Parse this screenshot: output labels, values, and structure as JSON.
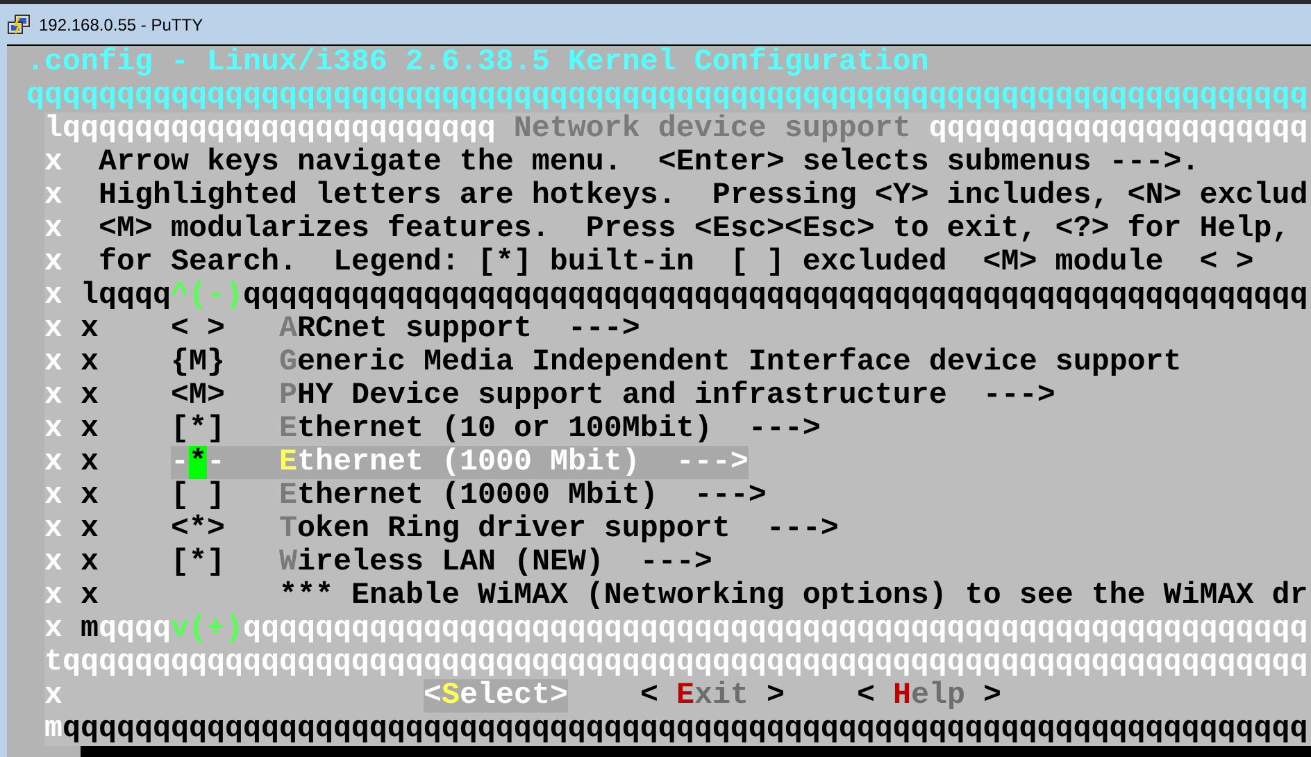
{
  "window": {
    "title": "192.168.0.55 - PuTTY"
  },
  "terminal": {
    "title": ".config - Linux/i386 2.6.38.5 Kernel Configuration",
    "rule": "qqqqqqqqqqqqqqqqqqqqqqqqqqqqqqqqqqqqqqqqqqqqqqqqqqqqqqqqqqqqqqqqqqqqqqq",
    "dialog": {
      "header": {
        "left": "lqqqqqqqqqqqqqqqqqqqqqqqq",
        "title": "Network device support",
        "right": "qqqqqqqqqqqqqqqqqqqqq"
      },
      "rows": [
        {
          "kind": "help",
          "border": "x",
          "text": "Arrow keys navigate the menu.  <Enter> selects submenus --->."
        },
        {
          "kind": "help",
          "border": "x",
          "text": "Highlighted letters are hotkeys.  Pressing <Y> includes, <N> exclud"
        },
        {
          "kind": "help",
          "border": "x",
          "text": "<M> modularizes features.  Press <Esc><Esc> to exit, <?> for Help,"
        },
        {
          "kind": "help",
          "border": "x",
          "text": "for Search.  Legend: [*] built-in  [ ] excluded  <M> module  < >"
        },
        {
          "kind": "list_edge",
          "border": "x",
          "segments": [
            {
              "text": "lqqqq",
              "kind": "dark"
            },
            {
              "text": "^(-)",
              "kind": "arrow"
            },
            {
              "text": "qqqqqqqqqqqqqqqqqqqqqqqqqqqqqqqqqqqqqqqqqqqqqqqqqqqqqqqqqqq",
              "kind": "dark"
            }
          ]
        },
        {
          "kind": "item",
          "border": "x",
          "inner": "x",
          "prompt": "< >",
          "hotkey": "A",
          "label": "RCnet support  --->",
          "selected": false,
          "cursor": false
        },
        {
          "kind": "item",
          "border": "x",
          "inner": "x",
          "prompt": "{M}",
          "hotkey": "G",
          "label": "eneric Media Independent Interface device support",
          "selected": false,
          "cursor": false
        },
        {
          "kind": "item",
          "border": "x",
          "inner": "x",
          "prompt": "<M>",
          "hotkey": "P",
          "label": "HY Device support and infrastructure  --->",
          "selected": false,
          "cursor": false
        },
        {
          "kind": "item",
          "border": "x",
          "inner": "x",
          "prompt": "[*]",
          "hotkey": "E",
          "label": "thernet (10 or 100Mbit)  --->",
          "selected": false,
          "cursor": false
        },
        {
          "kind": "item",
          "border": "x",
          "inner": "x",
          "prompt": "-*-",
          "hotkey": "E",
          "label": "thernet (1000 Mbit)  --->",
          "selected": true,
          "cursor": true
        },
        {
          "kind": "item",
          "border": "x",
          "inner": "x",
          "prompt": "[ ]",
          "hotkey": "E",
          "label": "thernet (10000 Mbit)  --->",
          "selected": false,
          "cursor": false
        },
        {
          "kind": "item",
          "border": "x",
          "inner": "x",
          "prompt": "<*>",
          "hotkey": "T",
          "label": "oken Ring driver support  --->",
          "selected": false,
          "cursor": false
        },
        {
          "kind": "item",
          "border": "x",
          "inner": "x",
          "prompt": "[*]",
          "hotkey": "W",
          "label": "ireless LAN (NEW)  --->",
          "selected": false,
          "cursor": false
        },
        {
          "kind": "comment",
          "border": "x",
          "inner": "x",
          "text": "*** Enable WiMAX (Networking options) to see the WiMAX dr"
        },
        {
          "kind": "list_edge",
          "border": "x",
          "segments": [
            {
              "text": "m",
              "kind": "dark"
            },
            {
              "text": "qqqq",
              "kind": "light"
            },
            {
              "text": "v(+)",
              "kind": "arrow"
            },
            {
              "text": "qqqqqqqqqqqqqqqqqqqqqqqqqqqqqqqqqqqqqqqqqqqqqqqqqqqqqqqqqqq",
              "kind": "light"
            }
          ]
        },
        {
          "kind": "edge",
          "segments": [
            {
              "text": "tqqqqqqqqqqqqqqqqqqqqqqqqqqqqqqqqqqqqqqqqqqqqqqqqqqqqqqqqqqqqqqqqqqqqq",
              "kind": "light"
            }
          ]
        },
        {
          "kind": "buttons",
          "border": "x",
          "buttons": [
            {
              "open": "<",
              "hotkey": "S",
              "rest": "elect",
              "close": ">",
              "selected": true
            },
            {
              "open": "< ",
              "hotkey": "E",
              "rest": "xit",
              "close": " >",
              "selected": false
            },
            {
              "open": "< ",
              "hotkey": "H",
              "rest": "elp",
              "close": " >",
              "selected": false
            }
          ]
        },
        {
          "kind": "edge",
          "segments": [
            {
              "text": "m",
              "kind": "light"
            },
            {
              "text": "qqqqqqqqqqqqqqqqqqqqqqqqqqqqqqqqqqqqqqqqqqqqqqqqqqqqqqqqqqqqqqqqqqqqq",
              "kind": "dark"
            }
          ]
        }
      ]
    }
  }
}
